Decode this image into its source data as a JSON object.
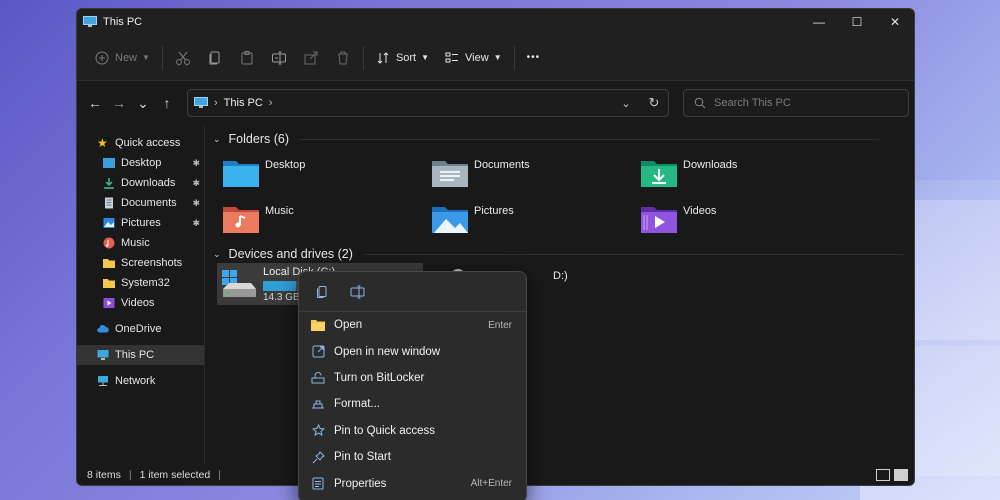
{
  "window": {
    "title": "This PC",
    "minimize_glyph": "—",
    "maximize_glyph": "☐",
    "close_glyph": "✕"
  },
  "toolbar": {
    "new_label": "New",
    "sort_label": "Sort",
    "view_label": "View",
    "more_glyph": "•••",
    "icons": [
      "plus-icon",
      "cut-icon",
      "copy-icon",
      "paste-icon",
      "rename-icon",
      "share-icon",
      "delete-icon",
      "sort-icon",
      "view-icon",
      "more-icon"
    ]
  },
  "nav": {
    "back": "←",
    "forward": "→",
    "recent": "⌄",
    "up": "↑"
  },
  "address": {
    "crumb": "This PC",
    "sep": "›",
    "dropdown_glyph": "⌄",
    "refresh_glyph": "↻"
  },
  "search": {
    "placeholder": "Search This PC"
  },
  "sidebar": {
    "quick_access": "Quick access",
    "items": [
      {
        "label": "Desktop",
        "pinned": true
      },
      {
        "label": "Downloads",
        "pinned": true
      },
      {
        "label": "Documents",
        "pinned": true
      },
      {
        "label": "Pictures",
        "pinned": true
      },
      {
        "label": "Music",
        "pinned": false
      },
      {
        "label": "Screenshots",
        "pinned": false
      },
      {
        "label": "System32",
        "pinned": false
      },
      {
        "label": "Videos",
        "pinned": false
      }
    ],
    "onedrive": "OneDrive",
    "this_pc": "This PC",
    "network": "Network",
    "pin_glyph": "📌"
  },
  "folders": {
    "heading": "Folders (6)",
    "items": [
      "Desktop",
      "Documents",
      "Downloads",
      "Music",
      "Pictures",
      "Videos"
    ]
  },
  "devices": {
    "heading": "Devices and drives (2)",
    "drive_name": "Local Disk (C:)",
    "drive_free": "14.3 GB",
    "drive_used_fraction": 0.22,
    "dvd_label_visible": "D:)"
  },
  "status": {
    "items": "8 items",
    "selected": "1 item selected",
    "sep": "|"
  },
  "context_menu": {
    "quick_actions": [
      "copy-icon",
      "rename-icon"
    ],
    "items": [
      {
        "label": "Open",
        "shortcut": "Enter",
        "icon": "folder-open-icon"
      },
      {
        "label": "Open in new window",
        "shortcut": "",
        "icon": "new-window-icon"
      },
      {
        "label": "Turn on BitLocker",
        "shortcut": "",
        "icon": "bitlocker-icon"
      },
      {
        "label": "Format...",
        "shortcut": "",
        "icon": "format-icon"
      },
      {
        "label": "Pin to Quick access",
        "shortcut": "",
        "icon": "star-icon"
      },
      {
        "label": "Pin to Start",
        "shortcut": "",
        "icon": "pin-icon"
      },
      {
        "label": "Properties",
        "shortcut": "Alt+Enter",
        "icon": "properties-icon"
      }
    ]
  },
  "colors": {
    "accent": "#2f9fd8",
    "window_bg": "#191919",
    "menu_bg": "#2b2b2b"
  }
}
